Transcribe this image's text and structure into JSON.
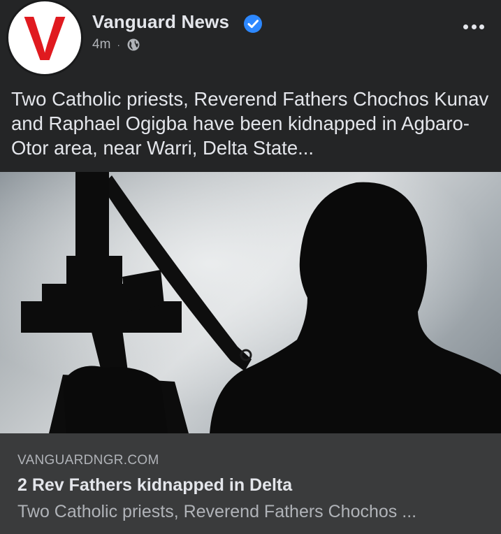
{
  "post": {
    "page_name": "Vanguard News",
    "verified": true,
    "time": "4m",
    "separator": "·",
    "audience_icon": "globe-icon",
    "more_icon": "more-options-icon",
    "caption": "Two Catholic priests, Reverend Fathers Chochos Kunav and Raphael Ogigba have been kidnapped in Agbaro-Otor area, near Warri, Delta State..."
  },
  "avatar": {
    "letter": "V",
    "color": "#e01a1f"
  },
  "link_preview": {
    "domain": "VANGUARDNGR.COM",
    "title": "2 Rev Fathers kidnapped in Delta",
    "description": "Two Catholic priests, Reverend Fathers Chochos ..."
  },
  "colors": {
    "background": "#242526",
    "card": "#3a3b3c",
    "text_primary": "#e4e6eb",
    "text_secondary": "#b0b3b8",
    "verified_badge": "#2d88ff"
  }
}
